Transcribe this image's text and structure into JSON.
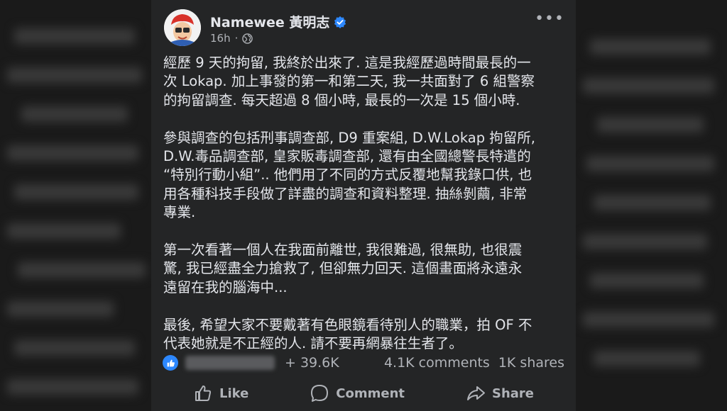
{
  "post": {
    "author": "Namewee 黃明志",
    "time": "16h",
    "paragraphs": [
      [
        "經歷 9 天的拘留, 我終於出來了. 這是我經歷過時間最長的一",
        "次 Lokap. 加上事發的第一和第二天, 我一共面對了 6 組警察",
        "的拘留調查. 每天超過 8 個小時, 最長的一次是 15 個小時."
      ],
      [
        "參與調查的包括刑事調查部, D9 重案組, D.W.Lokap 拘留所,",
        "D.W.毒品調查部, 皇家販毒調查部, 還有由全國總警長特遣的",
        "“特別行動小組”.. 他們用了不同的方式反覆地幫我錄口供, 也",
        "用各種科技手段做了詳盡的調查和資料整理. 抽絲剝繭, 非常",
        "專業."
      ],
      [
        "第一次看著一個人在我面前離世, 我很難過, 很無助, 也很震",
        "驚, 我已經盡全力搶救了, 但卻無力回天. 這個畫面將永遠永",
        "遠留在我的腦海中..."
      ],
      [
        "最後, 希望大家不要戴著有色眼鏡看待別人的職業，拍 OF 不",
        "代表她就是不正經的人. 請不要再網暴往生者了。"
      ]
    ],
    "reactions_count": "+ 39.6K",
    "comments": "4.1K comments",
    "shares": "1K shares"
  },
  "actions": {
    "like": "Like",
    "comment": "Comment",
    "share": "Share"
  },
  "colors": {
    "card_bg": "#242526",
    "text_primary": "#e4e6eb",
    "text_secondary": "#b0b3b8",
    "accent": "#2d88ff"
  }
}
